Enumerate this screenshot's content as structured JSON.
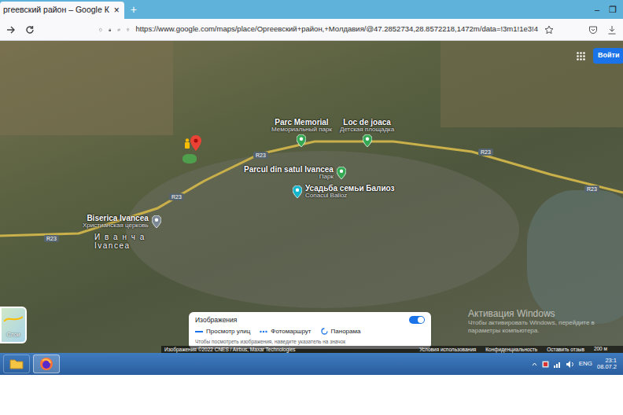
{
  "browser": {
    "tab": {
      "title": "ргеевский район – Google К",
      "close": "×",
      "selected": true
    },
    "new_tab": "+",
    "window_controls": [
      "–",
      "❐"
    ],
    "url": "https://www.google.com/maps/place/Оргеевский+район,+Молдавия/@47.2852734,28.8572218,1472m/data=!3m1!1e3!4"
  },
  "header": {
    "sign_in": "Войти"
  },
  "map": {
    "places": [
      {
        "name": "Parc Memorial",
        "subtitle": "Мемориальный парк",
        "color": "#34a853"
      },
      {
        "name": "Loc de joaca",
        "subtitle": "Детская площадка",
        "color": "#34a853"
      },
      {
        "name": "Parcul din satul Ivancea",
        "subtitle": "Парк",
        "color": "#34a853"
      },
      {
        "name": "Усадьба семьи Балиоз",
        "subtitle": "Conacul Balioz",
        "color": "#12b5cb"
      },
      {
        "name": "Biserica Ivancea",
        "subtitle": "Христианская церковь",
        "color": "#7b8794"
      }
    ],
    "road_labels": [
      "R23",
      "R23",
      "R23",
      "R23",
      "R23"
    ],
    "village": {
      "name_ru": "И в а н ч а",
      "name_ro": "Ivancea"
    }
  },
  "layers_button": {
    "label": "Слои"
  },
  "imagery_panel": {
    "title": "Изображения",
    "toggle_on": true,
    "options": [
      {
        "label": "Просмотр улиц",
        "kind": "line"
      },
      {
        "label": "Фотомаршрут",
        "kind": "dots"
      },
      {
        "label": "Панорама",
        "kind": "arc"
      }
    ],
    "hint": "Чтобы посмотреть изображения, наведите указатель на значок"
  },
  "footer": {
    "credits": "Изображения ©2022 CNES / Airbus, Maxar Technologies",
    "links": [
      "Условия использования",
      "Конфиденциальность",
      "Оставить отзыв"
    ],
    "scale": "200 м"
  },
  "watermark": {
    "title": "Активация Windows",
    "lines": [
      "Чтобы активировать Windows, перейдите в",
      "параметры компьютера."
    ]
  },
  "taskbar": {
    "lang": "ENG",
    "time": "23:1",
    "date": "08.07.2"
  }
}
